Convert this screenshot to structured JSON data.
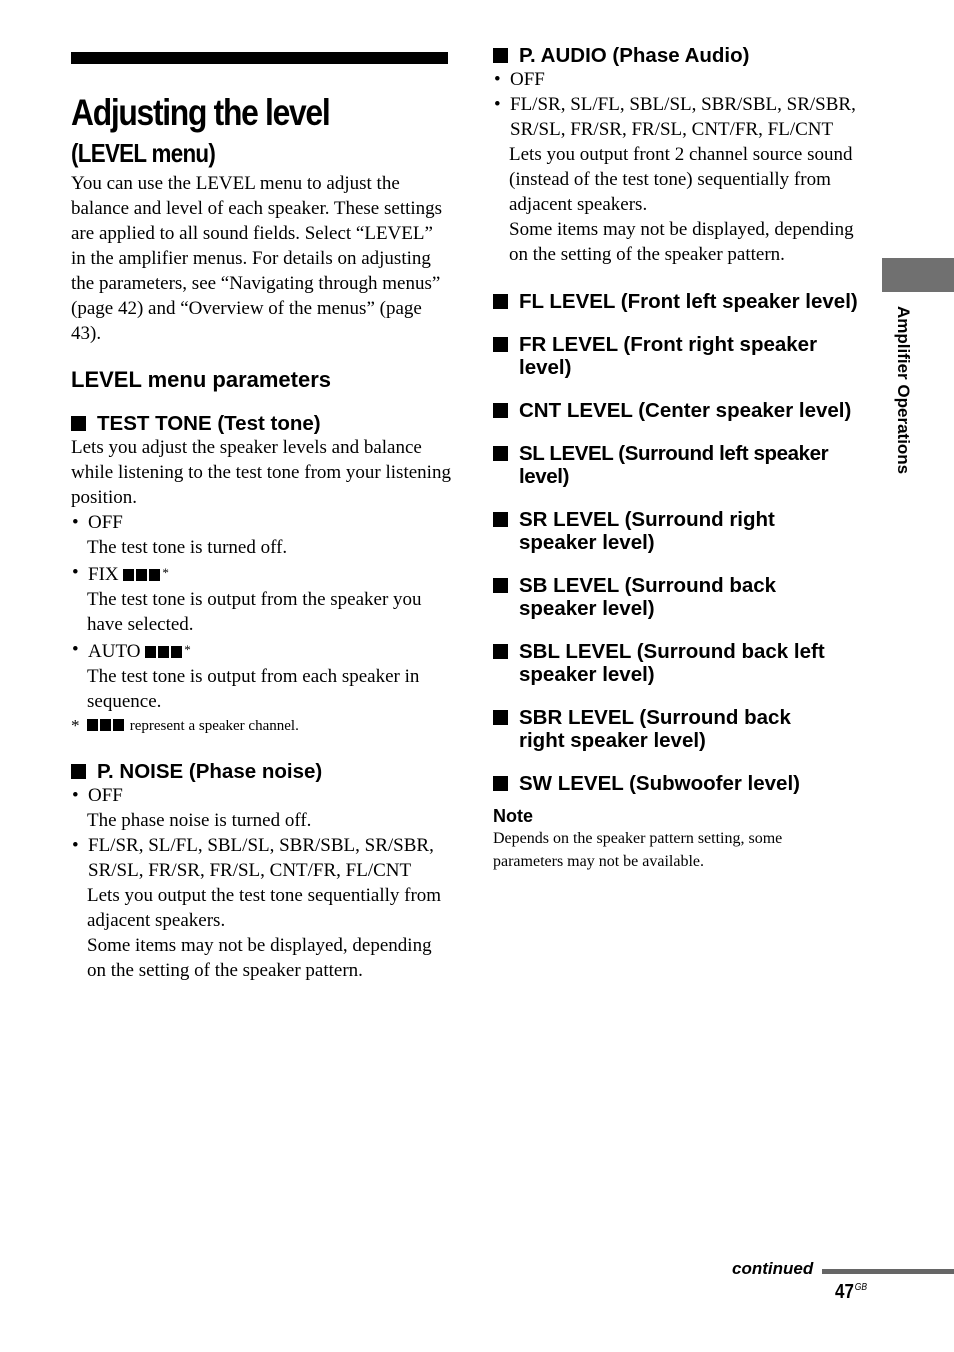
{
  "page": {
    "title": "Adjusting the level",
    "subtitle": "(LEVEL menu)",
    "intro": "You can use the LEVEL menu to adjust the balance and level of each speaker. These settings are applied to all sound fields. Select “LEVEL” in the amplifier menus. For details on adjusting the parameters, see “Navigating through menus” (page 42) and “Overview of the menus” (page 43).",
    "section_heading": "LEVEL menu parameters",
    "side_tab_label": "Amplifier Operations",
    "continued_label": "continued",
    "page_number": "47",
    "page_suffix": "GB"
  },
  "test_tone": {
    "heading": "TEST TONE (Test tone)",
    "description": "Lets you adjust the speaker levels and balance while listening to the test tone from your listening position.",
    "options": [
      {
        "label": "OFF",
        "description": "The test tone is turned off."
      },
      {
        "label": "FIX",
        "description": "The test tone is output from the speaker you have selected."
      },
      {
        "label": "AUTO",
        "description": "The test tone is output from each speaker in sequence."
      }
    ],
    "asterisk": "*",
    "footnote_mark": "*",
    "footnote": "represent a speaker channel."
  },
  "p_noise": {
    "heading": "P. NOISE (Phase noise)",
    "options": [
      {
        "label": "OFF",
        "description": "The phase noise is turned off."
      },
      {
        "label": "FL/SR, SL/FL, SBL/SL, SBR/SBL, SR/SBR, SR/SL, FR/SR, FR/SL, CNT/FR, FL/CNT",
        "description": "Lets you output the test tone sequentially from adjacent speakers.",
        "description2": "Some items may not be displayed, depending on the setting of the speaker pattern."
      }
    ]
  },
  "p_audio": {
    "heading": "P. AUDIO (Phase Audio)",
    "options": [
      {
        "label": "OFF"
      },
      {
        "label": "FL/SR, SL/FL, SBL/SL, SBR/SBL, SR/SBR, SR/SL, FR/SR, FR/SL, CNT/FR, FL/CNT",
        "description": "Lets you output front 2 channel source sound (instead of the test tone) sequentially from adjacent speakers.",
        "description2": "Some items may not be displayed, depending on the setting of the speaker pattern."
      }
    ]
  },
  "level_headings": [
    "FL LEVEL (Front left speaker level)",
    "FR LEVEL (Front right speaker level)",
    "CNT LEVEL (Center speaker level)",
    "SL LEVEL (Surround left speaker level)",
    "SR LEVEL (Surround right speaker level)",
    "SB LEVEL (Surround back speaker level)",
    "SBL LEVEL (Surround back left speaker level)",
    "SBR LEVEL (Surround back right speaker level)",
    "SW LEVEL (Subwoofer level)"
  ],
  "note": {
    "label": "Note",
    "text": "Depends on the speaker pattern setting, some parameters may not be available."
  }
}
